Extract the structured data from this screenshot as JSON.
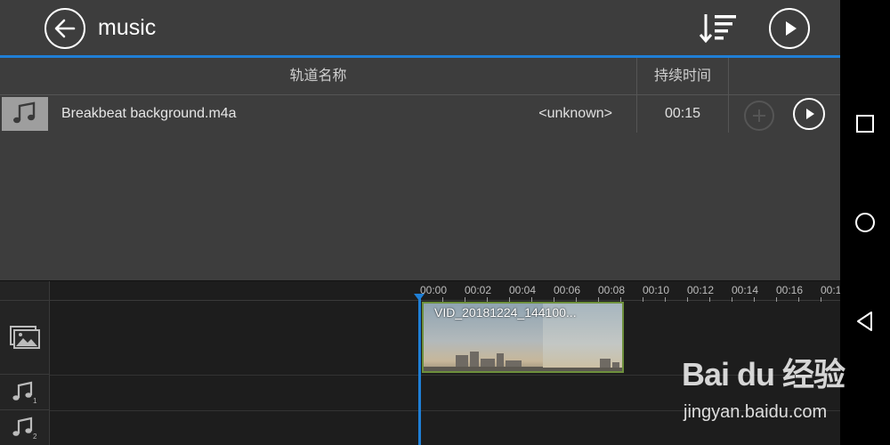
{
  "header": {
    "title": "music"
  },
  "list": {
    "col_name": "轨道名称",
    "col_duration": "持续时间",
    "tracks": [
      {
        "name": "Breakbeat background.m4a",
        "artist": "<unknown>",
        "duration": "00:15"
      }
    ]
  },
  "timeline": {
    "ticks": [
      "00:00",
      "00:02",
      "00:04",
      "00:06",
      "00:08",
      "00:10",
      "00:12",
      "00:14",
      "00:16",
      "00:1"
    ],
    "clip_name": "VID_20181224_144100...",
    "audio_lane_1": "1",
    "audio_lane_2": "2"
  },
  "watermark": {
    "logo": "Bai du 经验",
    "url": "jingyan.baidu.com"
  },
  "colors": {
    "accent": "#1f7fd6",
    "clip_border": "#6d8f3c",
    "panel": "#3d3d3d",
    "timeline_bg": "#1d1d1d"
  }
}
